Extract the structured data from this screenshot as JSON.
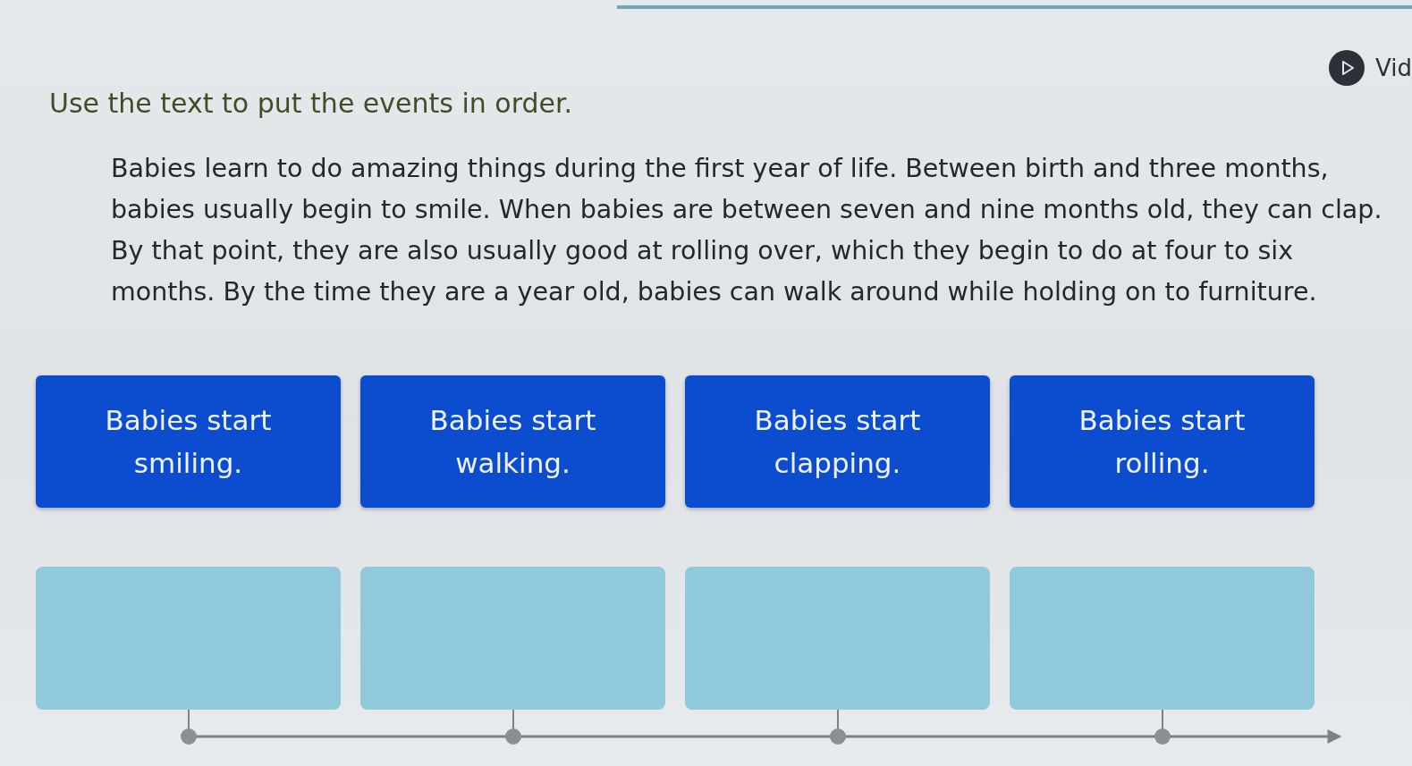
{
  "video_button": {
    "label": "Vid"
  },
  "instruction": "Use the text to put the events in order.",
  "passage": "Babies learn to do amazing things during the first year of life. Between birth and three months, babies usually begin to smile. When babies are between seven and nine months old, they can clap. By that point, they are also usually good at rolling over, which they begin to do at four to six months. By the time they are a year old, babies can walk around while holding on to furniture.",
  "event_cards": [
    {
      "label": "Babies start smiling."
    },
    {
      "label": "Babies start walking."
    },
    {
      "label": "Babies start clapping."
    },
    {
      "label": "Babies start rolling."
    }
  ]
}
